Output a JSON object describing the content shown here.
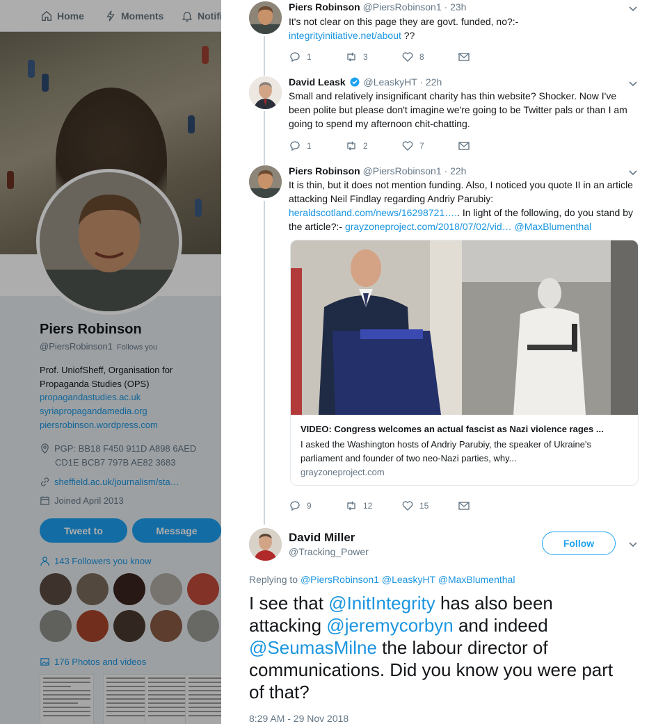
{
  "left_profile": {
    "nav": {
      "home": "Home",
      "moments": "Moments",
      "notifications": "Notifi"
    },
    "name": "Piers Robinson",
    "handle": "@PiersRobinson1",
    "follows_you": "Follows you",
    "bio": "Prof. UniofSheff, Organisation for Propaganda Studies (OPS)",
    "links": [
      "propagandastudies.ac.uk",
      "syriapropagandamedia.org",
      "piersrobinson.wordpress.com"
    ],
    "pgp_line1": "PGP: BB18 F450 911D A898 6AED",
    "pgp_line2": "CD1E BCB7 797B AE82 3683",
    "website": "sheffield.ac.uk/journalism/sta…",
    "joined": "Joined April 2013",
    "tweet_to_button": "Tweet to",
    "message_button": "Message",
    "followers_you_know": "143 Followers you know",
    "photos_and_videos": "176 Photos and videos"
  },
  "tweets": [
    {
      "name": "Piers Robinson",
      "handle": "@PiersRobinson1",
      "time": "· 23h",
      "text": "It's not clear on this page they are govt. funded, no?:-",
      "link": "integrityinitiative.net/about",
      "text_after": " ??",
      "replies": "1",
      "retweets": "3",
      "likes": "8"
    },
    {
      "name": "David Leask",
      "handle": "@LeaskyHT",
      "time": "· 22h",
      "text": "Small and relatively insignificant charity has thin website? Shocker.  Now I've been polite but please don't imagine we're going to be Twitter pals or than I am going to spend my afternoon chit-chatting.",
      "replies": "1",
      "retweets": "2",
      "likes": "7"
    },
    {
      "name": "Piers Robinson",
      "handle": "@PiersRobinson1",
      "time": "· 22h",
      "text_part1": "It is thin, but it does not mention funding. Also, I noticed you quote II in an article attacking Neil Findlay regarding Andriy Parubiy: ",
      "link1": "heraldscotland.com/news/16298721….",
      "text_part2": ". In light of the following, do you stand by the article?:- ",
      "link2": "grayzoneproject.com/2018/07/02/vid…",
      "mention": "@MaxBlumenthal",
      "card_title": "VIDEO: Congress welcomes an actual fascist as Nazi violence rages ...",
      "card_desc": "I asked the Washington hosts of Andriy Parubiy, the speaker of Ukraine's parliament and founder of two neo-Nazi parties, why...",
      "card_domain": "grayzoneproject.com",
      "replies": "9",
      "retweets": "12",
      "likes": "15"
    }
  ],
  "main_tweet": {
    "name": "David Miller",
    "handle": "@Tracking_Power",
    "follow_button": "Follow",
    "replying_label": "Replying to",
    "replying_to": "@PiersRobinson1 @LeaskyHT @MaxBlumenthal",
    "t1": "I see that ",
    "m1": "@InitIntegrity",
    "t2": " has also been attacking ",
    "m2": "@jeremycorbyn",
    "t3": " and indeed ",
    "m3": "@SeumasMilne",
    "t4": " the labour director of communications. Did you know you were part of that?",
    "timestamp": "8:29 AM - 29 Nov 2018"
  },
  "colors": {
    "accent": "#1da1f2",
    "link": "#1b95e0",
    "muted": "#657786",
    "text": "#14171a"
  }
}
